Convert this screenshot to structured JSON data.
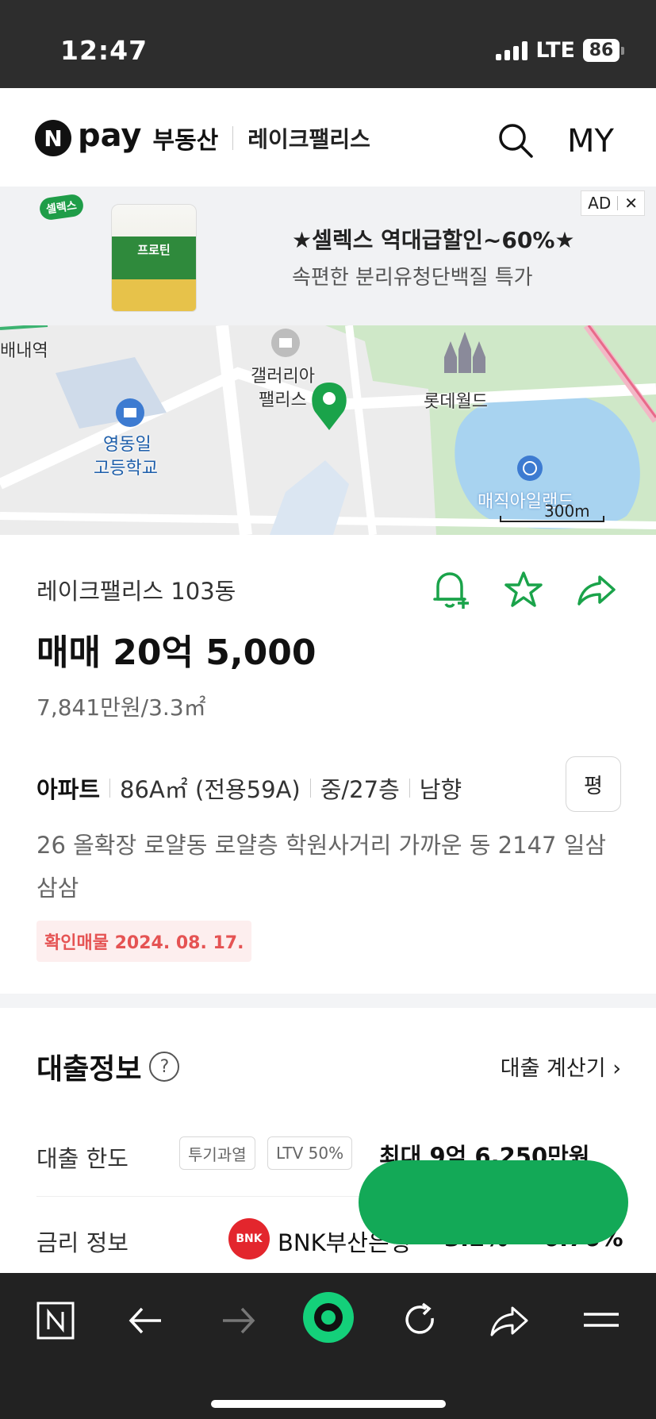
{
  "status": {
    "time": "12:47",
    "network": "LTE",
    "battery": "86"
  },
  "header": {
    "logo_letter": "N",
    "logo_pay": "pay",
    "logo_estate": "부동산",
    "complex_name": "레이크팰리스",
    "my_label": "MY"
  },
  "ad": {
    "brand": "셀렉스",
    "product_text": "프로틴",
    "tag_label": "AD",
    "close_label": "✕",
    "title": "★셀렉스 역대급할인~60%★",
    "subtitle": "속편한 분리유청단백질 특가"
  },
  "map": {
    "labels": {
      "station": "배내역",
      "gallery_line1": "갤러리아",
      "gallery_line2": "팰리스",
      "lotte": "롯데월드",
      "school_line1": "영동일",
      "school_line2": "고등학교",
      "magic": "매직아일랜드"
    },
    "scale": "300m"
  },
  "listing": {
    "name": "레이크팰리스 103동",
    "price": "매매 20억 5,000",
    "unit_price": "7,841만원/3.3㎡",
    "type": "아파트",
    "area": "86A㎡ (전용59A)",
    "floor": "중/27층",
    "direction": "남향",
    "pyeong_label": "평",
    "description": "26 올확장 로얄동 로얄층 학원사거리 가까운 동 2147 일삼삼삼",
    "verified": "확인매물 2024. 08. 17."
  },
  "loan": {
    "title": "대출정보",
    "help": "?",
    "calculator": "대출 계산기",
    "limit_label": "대출 한도",
    "chips": [
      "투기과열",
      "LTV 50%"
    ],
    "limit_value": "최대 9억 6,250만원",
    "rate_label": "금리 정보",
    "bank_logo": "BNK",
    "bank_name": "BNK부산은행",
    "rate_value": "3.2% ~ 6.76%"
  },
  "colors": {
    "accent_green": "#13a957",
    "pin_green": "#1aa34a",
    "verify_red": "#e55353",
    "bnk_red": "#e3262d"
  }
}
